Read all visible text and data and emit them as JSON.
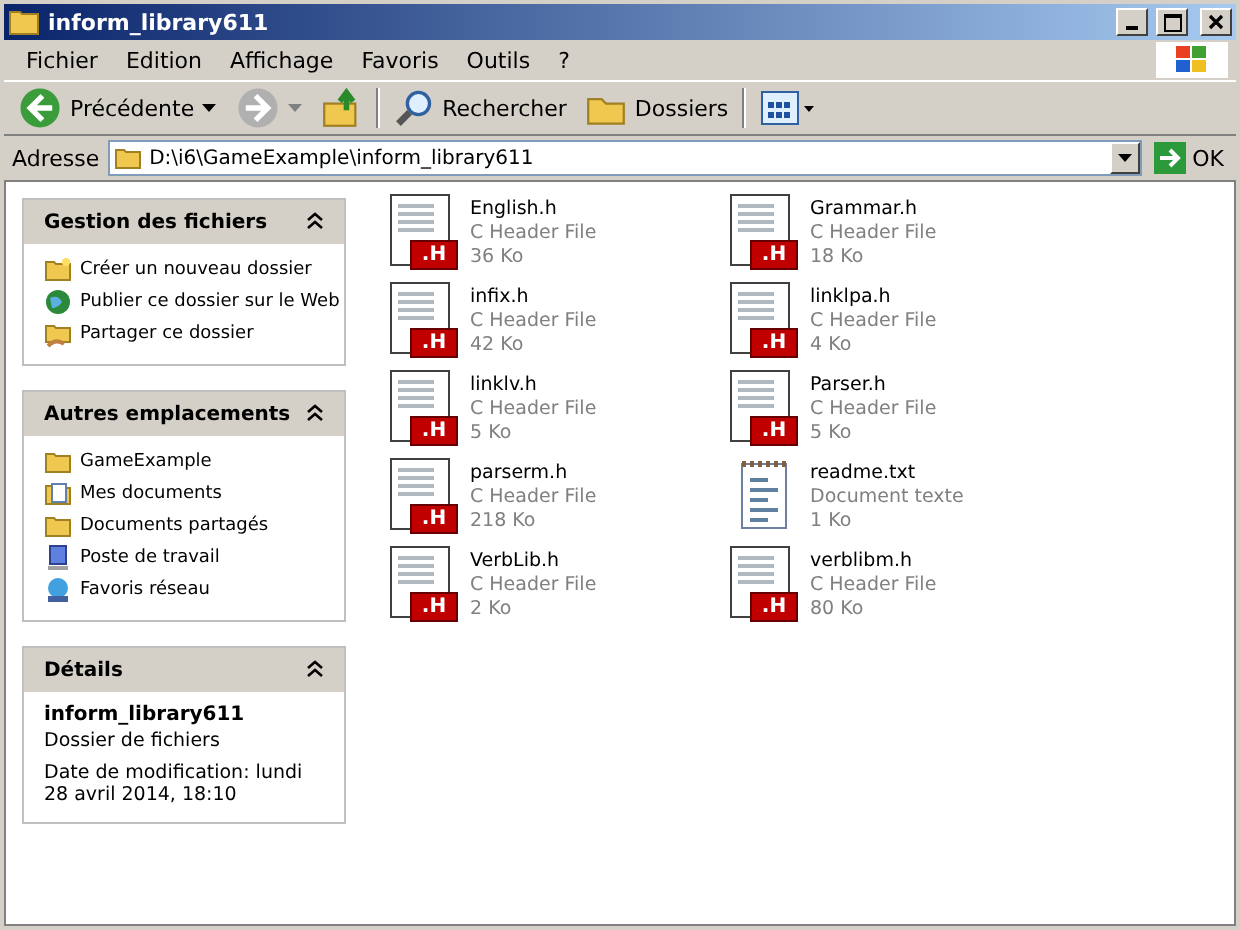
{
  "window": {
    "title": "inform_library611"
  },
  "menu": [
    "Fichier",
    "Edition",
    "Affichage",
    "Favoris",
    "Outils",
    "?"
  ],
  "toolbar": [
    {
      "kind": "back",
      "label": "Précédente",
      "disabled": false
    },
    {
      "kind": "forward",
      "disabled": true
    },
    {
      "kind": "up"
    },
    {
      "kind": "search",
      "label": "Rechercher"
    },
    {
      "kind": "folders",
      "label": "Dossiers"
    },
    {
      "kind": "views"
    }
  ],
  "address": {
    "label": "Adresse",
    "value": "D:\\i6\\GameExample\\inform_library611",
    "go": "OK"
  },
  "panels": [
    {
      "title": "Gestion des fichiers",
      "expanded": true,
      "items": [
        {
          "label": "Créer un nouveau dossier"
        },
        {
          "label": "Publier ce dossier sur le Web"
        },
        {
          "label": "Partager ce dossier"
        }
      ]
    },
    {
      "title": "Autres emplacements",
      "expanded": true,
      "items": [
        {
          "label": "GameExample"
        },
        {
          "label": "Mes documents"
        },
        {
          "label": "Documents partagés"
        },
        {
          "label": "Poste de travail"
        },
        {
          "label": "Favoris réseau"
        }
      ]
    }
  ],
  "details": {
    "title": "Détails",
    "expanded": true,
    "name": "inform_library611",
    "type": "Dossier de fichiers",
    "modified": "Date de modification: lundi 28 avril 2014, 18:10"
  },
  "files": [
    {
      "name": "English.h",
      "type": "C Header File",
      "size": "36 Ko",
      "kind": "header",
      "badge": ".H"
    },
    {
      "name": "Grammar.h",
      "type": "C Header File",
      "size": "18 Ko",
      "kind": "header",
      "badge": ".H"
    },
    {
      "name": "infix.h",
      "type": "C Header File",
      "size": "42 Ko",
      "kind": "header",
      "badge": ".H"
    },
    {
      "name": "linklpa.h",
      "type": "C Header File",
      "size": "4 Ko",
      "kind": "header",
      "badge": ".H"
    },
    {
      "name": "linklv.h",
      "type": "C Header File",
      "size": "5 Ko",
      "kind": "header",
      "badge": ".H"
    },
    {
      "name": "Parser.h",
      "type": "C Header File",
      "size": "5 Ko",
      "kind": "header",
      "badge": ".H"
    },
    {
      "name": "parserm.h",
      "type": "C Header File",
      "size": "218 Ko",
      "kind": "header",
      "badge": ".H"
    },
    {
      "name": "readme.txt",
      "type": "Document texte",
      "size": "1 Ko",
      "kind": "text"
    },
    {
      "name": "VerbLib.h",
      "type": "C Header File",
      "size": "2 Ko",
      "kind": "header",
      "badge": ".H"
    },
    {
      "name": "verblibm.h",
      "type": "C Header File",
      "size": "80 Ko",
      "kind": "header",
      "badge": ".H"
    }
  ]
}
